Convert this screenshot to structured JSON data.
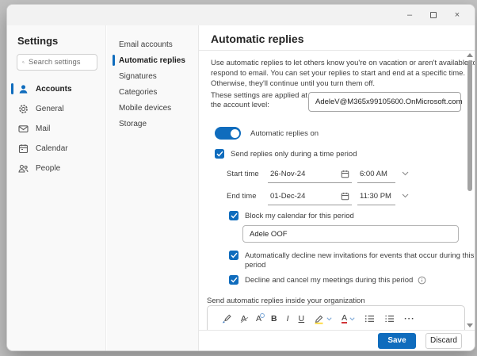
{
  "window_controls": {
    "minimize_glyph": "–",
    "close_glyph": "×"
  },
  "sidebar": {
    "title": "Settings",
    "search_placeholder": "Search settings",
    "items": [
      {
        "label": "Accounts",
        "selected": true
      },
      {
        "label": "General"
      },
      {
        "label": "Mail"
      },
      {
        "label": "Calendar"
      },
      {
        "label": "People"
      }
    ]
  },
  "subnav": {
    "items": [
      {
        "label": "Email accounts"
      },
      {
        "label": "Automatic replies",
        "selected": true
      },
      {
        "label": "Signatures"
      },
      {
        "label": "Categories"
      },
      {
        "label": "Mobile devices"
      },
      {
        "label": "Storage"
      }
    ]
  },
  "main": {
    "title": "Automatic replies",
    "description_lines": [
      "Use automatic replies to let others know you're on vacation or aren't available to",
      "respond to email. You can set your replies to start and end at a specific time.",
      "Otherwise, they'll continue until you turn them off."
    ],
    "account_scope_label_lines": [
      "These settings are applied at",
      "the account level:"
    ],
    "account_value": "AdeleV@M365x99105600.OnMicrosoft.com",
    "toggle_label": "Automatic replies on",
    "time_period_label": "Send replies only during a time period",
    "start": {
      "label": "Start time",
      "date": "26-Nov-24",
      "time": "6:00 AM"
    },
    "end": {
      "label": "End time",
      "date": "01-Dec-24",
      "time": "11:30 PM"
    },
    "block_calendar_label": "Block my calendar for this period",
    "event_title_value": "Adele OOF",
    "decline_invitations_lines": [
      "Automatically decline new invitations for events that occur during this",
      "period"
    ],
    "decline_meetings_label": "Decline and cancel my meetings during this period",
    "inside_org_label": "Send automatic replies inside your organization",
    "footer": {
      "save": "Save",
      "discard": "Discard"
    }
  },
  "toolbar": {
    "clear_formatting_glyph": "A",
    "font_size_glyph": "A",
    "bold_glyph": "B",
    "italic_glyph": "I",
    "underline_glyph": "U",
    "font_color_glyph": "A",
    "more_glyph": "···"
  },
  "colors": {
    "accent": "#0f6cbd",
    "highlight_yellow": "#ffd93b",
    "font_color_red": "#d13438"
  }
}
